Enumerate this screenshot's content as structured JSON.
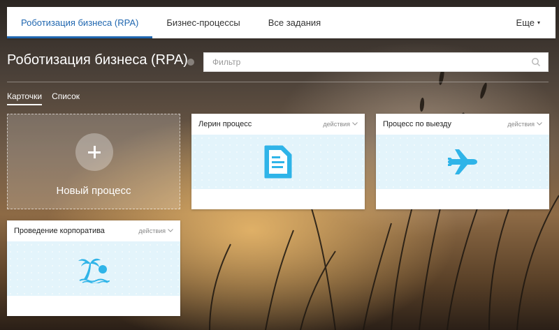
{
  "nav": {
    "tabs": [
      {
        "label": "Роботизация бизнеса (RPA)",
        "active": true
      },
      {
        "label": "Бизнес-процессы",
        "active": false
      },
      {
        "label": "Все задания",
        "active": false
      }
    ],
    "more_label": "Еще"
  },
  "page": {
    "title": "Роботизация бизнеса (RPA)"
  },
  "filter": {
    "placeholder": "Фильтр",
    "value": ""
  },
  "views": {
    "cards_label": "Карточки",
    "list_label": "Список",
    "active": "cards"
  },
  "new_process": {
    "label": "Новый процесс"
  },
  "cards": [
    {
      "title": "Лерин процесс",
      "actions_label": "действия",
      "icon": "document-icon"
    },
    {
      "title": "Процесс по выезду",
      "actions_label": "действия",
      "icon": "airplane-icon"
    },
    {
      "title": "Проведение корпоратива",
      "actions_label": "действия",
      "icon": "palm-beach-icon"
    }
  ],
  "colors": {
    "accent": "#2067b0",
    "icon": "#2fb4e8",
    "card_body": "#e3f4fb"
  }
}
